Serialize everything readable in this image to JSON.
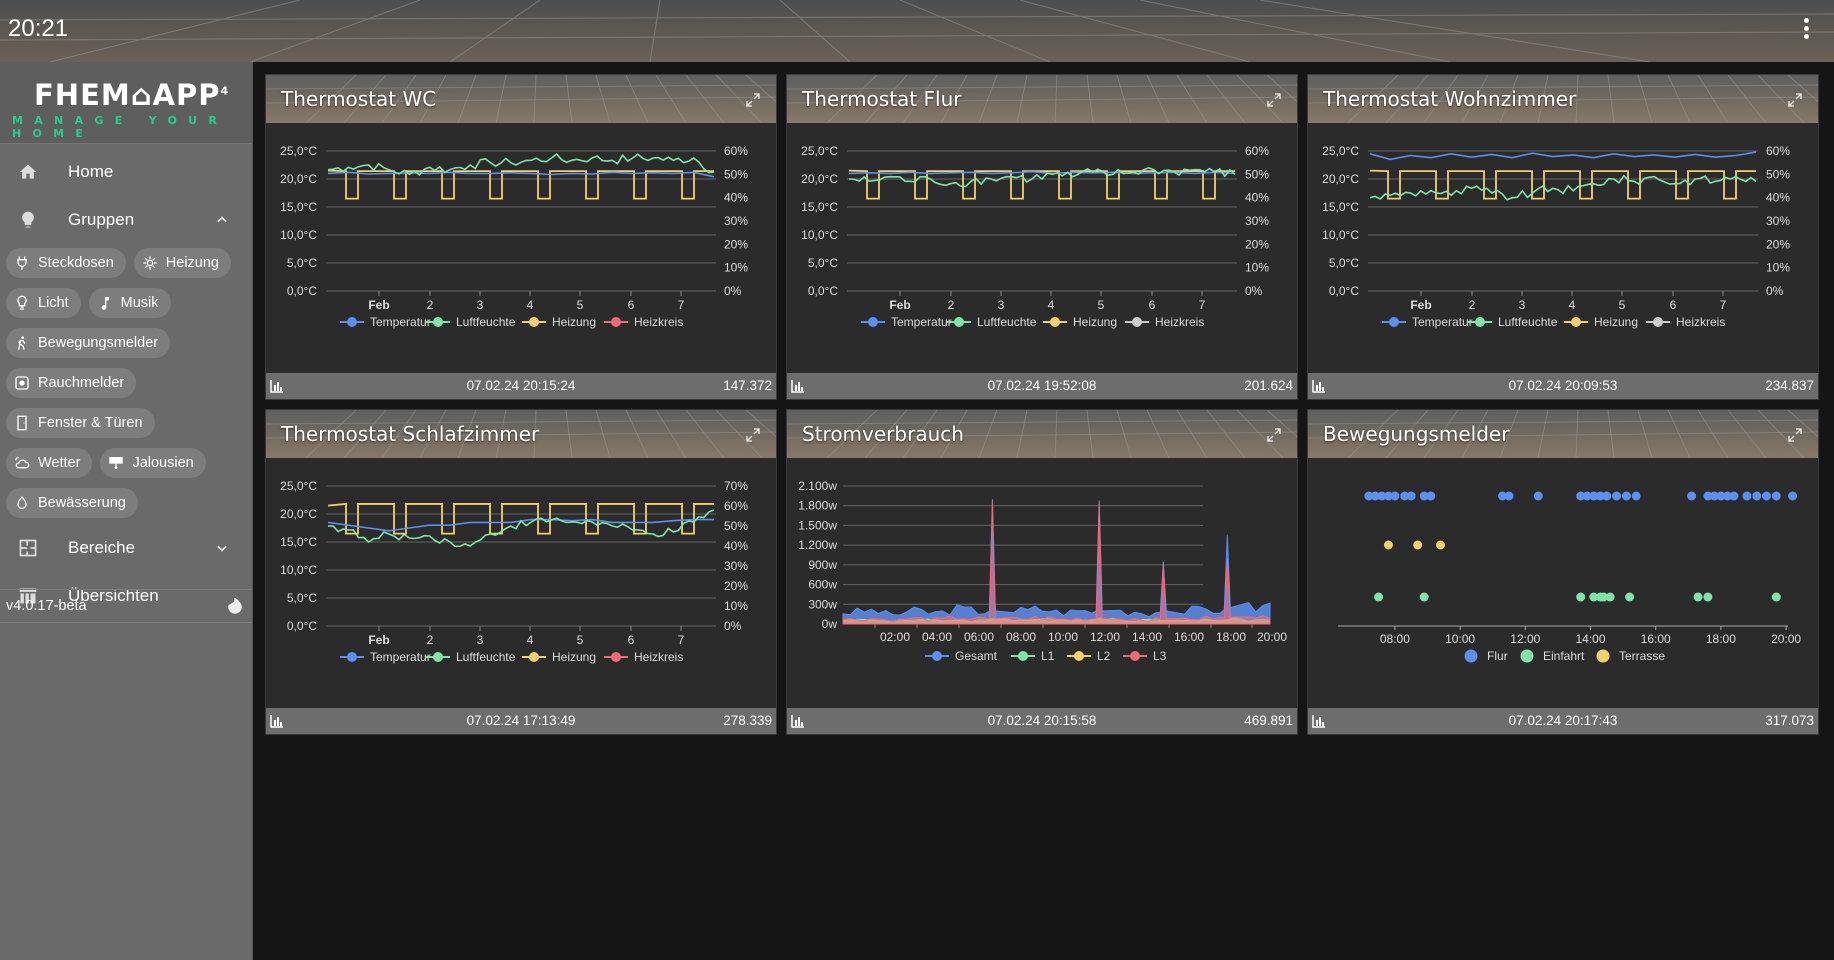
{
  "topbar": {
    "time": "20:21"
  },
  "logo": {
    "line1": "FHEM⌂APP",
    "superscript": "4",
    "line2": "MANAGE YOUR HOME",
    "accent": "#22d08e"
  },
  "sidebar": {
    "home": "Home",
    "groups": "Gruppen",
    "chips": [
      "Steckdosen",
      "Heizung",
      "Licht",
      "Musik",
      "Bewegungsmelder",
      "Rauchmelder",
      "Fenster & Türen",
      "Wetter",
      "Jalousien",
      "Bewässerung"
    ],
    "areas": "Bereiche",
    "overviews": "Übersichten",
    "version": "v4.0.17-beta"
  },
  "cards": [
    {
      "title": "Thermostat WC",
      "timestamp": "07.02.24 20:15:24",
      "value": "147.372"
    },
    {
      "title": "Thermostat Flur",
      "timestamp": "07.02.24 19:52:08",
      "value": "201.624"
    },
    {
      "title": "Thermostat Wohnzimmer",
      "timestamp": "07.02.24 20:09:53",
      "value": "234.837"
    },
    {
      "title": "Thermostat Schlafzimmer",
      "timestamp": "07.02.24 17:13:49",
      "value": "278.339"
    },
    {
      "title": "Stromverbrauch",
      "timestamp": "07.02.24 20:15:58",
      "value": "469.891"
    },
    {
      "title": "Bewegungsmelder",
      "timestamp": "07.02.24 20:17:43",
      "value": "317.073"
    }
  ],
  "colors": {
    "blue": "#5b8ff0",
    "green": "#7de6a6",
    "yellow": "#f2d06b",
    "red": "#ef6b7a",
    "gray": "#cccccc"
  },
  "chart_data": [
    {
      "type": "line",
      "x_ticks": [
        "Feb",
        "2",
        "3",
        "4",
        "5",
        "6",
        "7"
      ],
      "y_left_ticks": [
        "0,0°C",
        "5,0°C",
        "10,0°C",
        "15,0°C",
        "20,0°C",
        "25,0°C"
      ],
      "y_right_ticks": [
        "0%",
        "10%",
        "20%",
        "30%",
        "40%",
        "50%",
        "60%"
      ],
      "ylim_left": [
        0,
        25
      ],
      "ylim_right": [
        0,
        60
      ],
      "series": [
        {
          "name": "Temperatur",
          "color": "#5b8ff0",
          "values": [
            21,
            21.2,
            20.9,
            21,
            21.1,
            21,
            21.2,
            21,
            21,
            21.1,
            21,
            20.8,
            21,
            20.9,
            21.2,
            21,
            21.1,
            21,
            21.2,
            20.4
          ]
        },
        {
          "name": "Luftfeuchte",
          "color": "#7de6a6",
          "values": [
            52,
            53,
            54,
            52,
            50,
            53,
            52,
            54,
            55,
            55,
            56,
            57,
            56,
            57,
            56,
            57,
            57,
            56,
            57,
            51
          ]
        },
        {
          "name": "Heizung",
          "color": "#f2d06b"
        },
        {
          "name": "Heizkreis",
          "color": "#ef6b7a"
        }
      ]
    },
    {
      "type": "line",
      "x_ticks": [
        "Feb",
        "2",
        "3",
        "4",
        "5",
        "6",
        "7"
      ],
      "y_left_ticks": [
        "0,0°C",
        "5,0°C",
        "10,0°C",
        "15,0°C",
        "20,0°C",
        "25,0°C"
      ],
      "y_right_ticks": [
        "0%",
        "10%",
        "20%",
        "30%",
        "40%",
        "50%",
        "60%"
      ],
      "ylim_left": [
        0,
        25
      ],
      "ylim_right": [
        0,
        60
      ],
      "series": [
        {
          "name": "Temperatur",
          "color": "#5b8ff0",
          "values": [
            21,
            21.1,
            21,
            21.2,
            21,
            21.1,
            21.2,
            21,
            21.1,
            21.3,
            21,
            21.2,
            21.1,
            21.2,
            21,
            21.1,
            21.2,
            21,
            21.2,
            21
          ]
        },
        {
          "name": "Luftfeuchte",
          "color": "#7de6a6",
          "values": [
            48,
            47,
            49,
            47,
            48,
            46,
            47,
            48,
            49,
            48,
            50,
            49,
            51,
            50,
            51,
            52,
            51,
            52,
            51,
            50
          ]
        },
        {
          "name": "Heizung",
          "color": "#f2d06b"
        },
        {
          "name": "Heizkreis",
          "color": "#cccccc"
        }
      ]
    },
    {
      "type": "line",
      "x_ticks": [
        "Feb",
        "2",
        "3",
        "4",
        "5",
        "6",
        "7"
      ],
      "y_left_ticks": [
        "0,0°C",
        "5,0°C",
        "10,0°C",
        "15,0°C",
        "20,0°C",
        "25,0°C"
      ],
      "y_right_ticks": [
        "0%",
        "10%",
        "20%",
        "30%",
        "40%",
        "50%",
        "60%"
      ],
      "ylim_left": [
        0,
        25
      ],
      "ylim_right": [
        0,
        60
      ],
      "series": [
        {
          "name": "Temperatur",
          "color": "#5b8ff0",
          "values": [
            24.5,
            23.5,
            24.2,
            23.8,
            24.5,
            23.9,
            24.4,
            23.8,
            24.6,
            24,
            24.3,
            23.8,
            24.5,
            24,
            24.3,
            23.9,
            24.4,
            23.9,
            24.2,
            24.8
          ]
        },
        {
          "name": "Luftfeuchte",
          "color": "#7de6a6",
          "values": [
            40,
            41,
            42,
            43,
            41,
            44,
            42,
            40,
            42,
            44,
            43,
            46,
            48,
            47,
            49,
            46,
            48,
            47,
            49,
            47
          ]
        },
        {
          "name": "Heizung",
          "color": "#f2d06b"
        },
        {
          "name": "Heizkreis",
          "color": "#cccccc"
        }
      ]
    },
    {
      "type": "line",
      "x_ticks": [
        "Feb",
        "2",
        "3",
        "4",
        "5",
        "6",
        "7"
      ],
      "y_left_ticks": [
        "0,0°C",
        "5,0°C",
        "10,0°C",
        "15,0°C",
        "20,0°C",
        "25,0°C"
      ],
      "y_right_ticks": [
        "0%",
        "10%",
        "20%",
        "30%",
        "40%",
        "50%",
        "60%",
        "70%"
      ],
      "ylim_left": [
        0,
        25
      ],
      "ylim_right": [
        0,
        70
      ],
      "series": [
        {
          "name": "Temperatur",
          "color": "#5b8ff0",
          "values": [
            18.5,
            18,
            17.5,
            17,
            17.5,
            18,
            18,
            18.5,
            18.5,
            18.5,
            19,
            19,
            18.8,
            19,
            18.5,
            18.5,
            18.5,
            18.8,
            19,
            19
          ]
        },
        {
          "name": "Luftfeuchte",
          "color": "#7de6a6",
          "values": [
            50,
            48,
            42,
            46,
            44,
            45,
            42,
            40,
            46,
            50,
            52,
            53,
            52,
            52,
            50,
            48,
            46,
            47,
            52,
            58
          ]
        },
        {
          "name": "Heizung",
          "color": "#f2d06b"
        },
        {
          "name": "Heizkreis",
          "color": "#ef6b7a"
        }
      ]
    },
    {
      "type": "area",
      "x_ticks": [
        "02:00",
        "04:00",
        "06:00",
        "08:00",
        "10:00",
        "12:00",
        "14:00",
        "16:00",
        "18:00",
        "20:00"
      ],
      "y_ticks": [
        "0w",
        "300w",
        "600w",
        "900w",
        "1.200w",
        "1.500w",
        "1.800w",
        "2.100w"
      ],
      "ylim": [
        0,
        2100
      ],
      "series": [
        {
          "name": "Gesamt",
          "color": "#5b8ff0",
          "values": [
            180,
            200,
            150,
            190,
            170,
            220,
            200,
            1900,
            200,
            220,
            180,
            200,
            1880,
            200,
            180,
            950,
            200,
            220,
            1350,
            250,
            300
          ]
        },
        {
          "name": "L1",
          "color": "#7de6a6",
          "values": [
            60,
            60,
            50,
            60,
            55,
            60,
            55,
            80,
            60,
            60,
            55,
            60,
            80,
            60,
            55,
            70,
            60,
            60,
            80,
            60,
            80
          ]
        },
        {
          "name": "L2",
          "color": "#f2d06b",
          "values": [
            50,
            50,
            50,
            50,
            50,
            50,
            50,
            60,
            50,
            50,
            50,
            50,
            60,
            50,
            50,
            60,
            50,
            50,
            60,
            50,
            60
          ]
        },
        {
          "name": "L3",
          "color": "#ef6b7a",
          "values": [
            70,
            80,
            60,
            80,
            70,
            90,
            80,
            1850,
            80,
            90,
            70,
            80,
            1830,
            80,
            70,
            900,
            80,
            90,
            1000,
            100,
            120
          ]
        }
      ]
    },
    {
      "type": "scatter",
      "x_ticks": [
        "08:00",
        "10:00",
        "12:00",
        "14:00",
        "16:00",
        "18:00",
        "20:00"
      ],
      "series": [
        {
          "name": "Flur",
          "color": "#5b8ff0",
          "x": [
            7.2,
            7.4,
            7.6,
            7.8,
            8.0,
            8.3,
            8.5,
            8.9,
            9.1,
            11.3,
            11.5,
            12.4,
            13.7,
            13.9,
            14.1,
            14.3,
            14.5,
            14.8,
            15.1,
            15.4,
            17.1,
            17.6,
            17.8,
            18.0,
            18.2,
            18.4,
            18.8,
            19.1,
            19.4,
            19.7,
            20.2
          ]
        },
        {
          "name": "Einfahrt",
          "color": "#7de6a6",
          "x": [
            7.5,
            8.9,
            13.7,
            14.1,
            14.3,
            14.4,
            14.6,
            15.2,
            17.3,
            17.6,
            19.7
          ]
        },
        {
          "name": "Terrasse",
          "color": "#f2d06b",
          "x": [
            7.8,
            8.7,
            9.4
          ]
        }
      ]
    }
  ]
}
